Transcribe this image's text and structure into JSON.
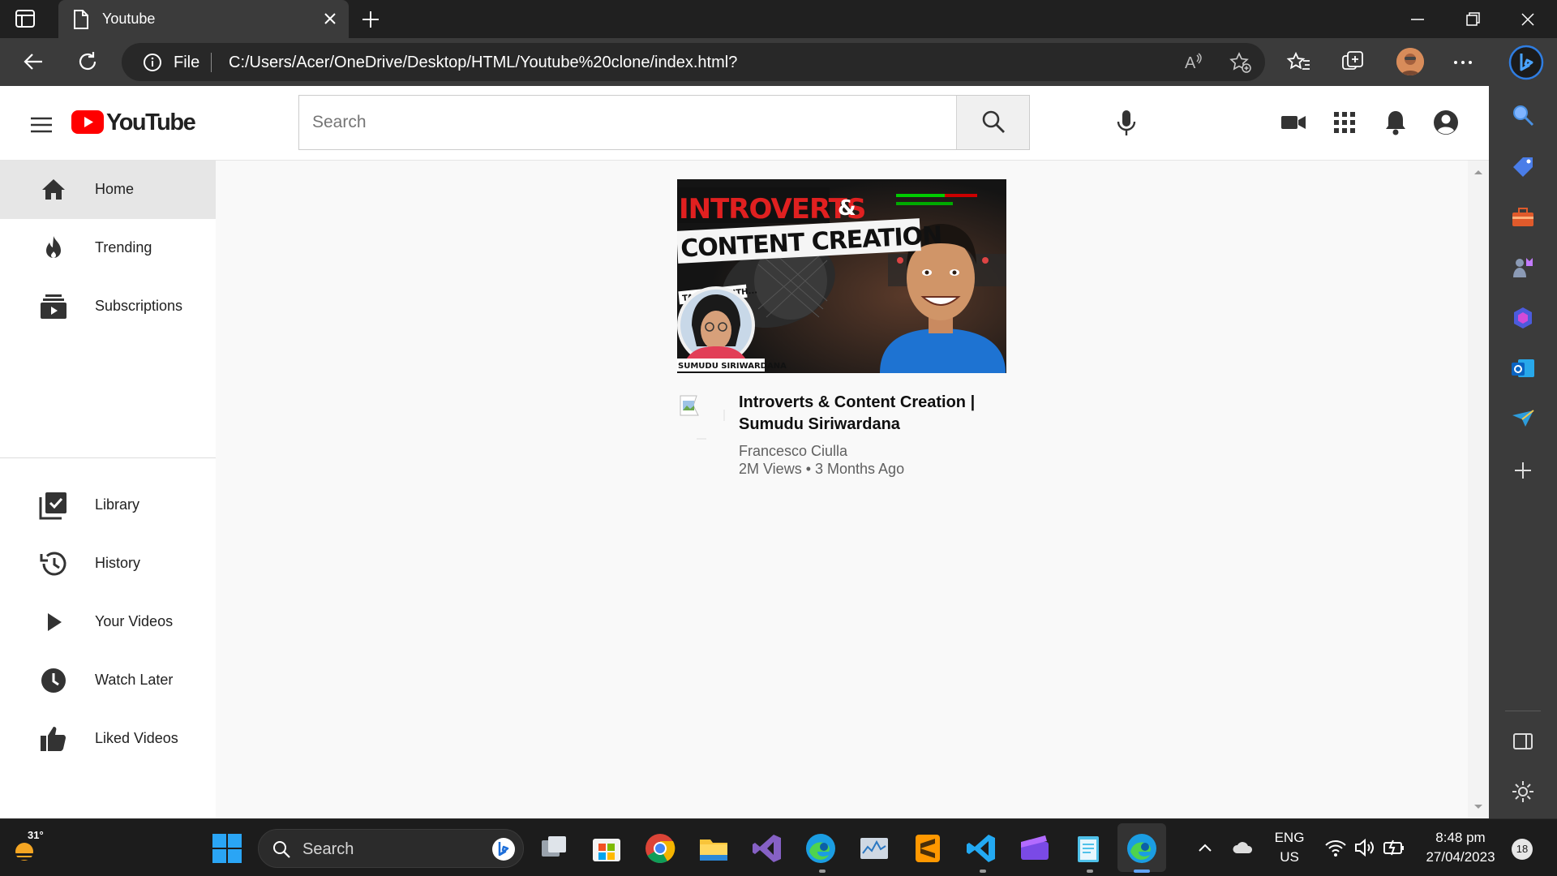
{
  "browser": {
    "tab_title": "Youtube",
    "address_scheme": "File",
    "url": "C:/Users/Acer/OneDrive/Desktop/HTML/Youtube%20clone/index.html?"
  },
  "youtube": {
    "logo_text": "YouTube",
    "search_placeholder": "Search",
    "sidebar": {
      "primary": [
        {
          "label": "Home",
          "icon": "home-icon",
          "active": true
        },
        {
          "label": "Trending",
          "icon": "fire-icon"
        },
        {
          "label": "Subscriptions",
          "icon": "subscriptions-icon"
        }
      ],
      "secondary": [
        {
          "label": "Library",
          "icon": "library-icon"
        },
        {
          "label": "History",
          "icon": "history-icon"
        },
        {
          "label": "Your Videos",
          "icon": "play-icon"
        },
        {
          "label": "Watch Later",
          "icon": "clock-icon"
        },
        {
          "label": "Liked Videos",
          "icon": "thumbs-up-icon"
        }
      ]
    },
    "video": {
      "thumbnail_text_line1": "INTROVERTS",
      "thumbnail_text_amp": "&",
      "thumbnail_text_line2": "CONTENT CREATION",
      "thumbnail_talking": "TALKING WITH...",
      "thumbnail_guest": "SUMUDU SIRIWARDANA",
      "title": "Introverts & Content Creation | Sumudu Siriwardana",
      "channel": "Francesco Ciulla",
      "meta": "2M Views • 3 Months Ago"
    }
  },
  "taskbar": {
    "temperature": "31°",
    "search_label": "Search",
    "lang_line1": "ENG",
    "lang_line2": "US",
    "time": "8:48 pm",
    "date": "27/04/2023",
    "notification_count": "18"
  },
  "colors": {
    "youtube_red": "#ff0000",
    "sidebar_active": "#e6e6e6",
    "browser_chrome": "#3b3b3b"
  }
}
